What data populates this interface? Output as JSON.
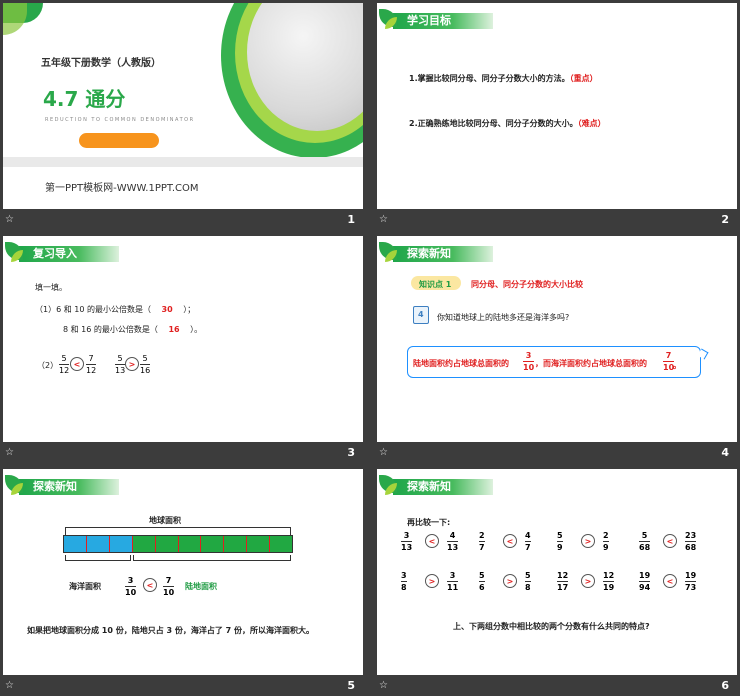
{
  "colors": {
    "accent_green": "#1f9b43",
    "accent_red": "#e02020",
    "accent_orange": "#f7941d",
    "background": "#3c3c3c"
  },
  "icons": {
    "favorite": "star-icon"
  },
  "slides": [
    {
      "number": "1",
      "subtitle": "五年级下册数学（人教版）",
      "title": "4.7  通分",
      "english": "REDUCTION TO COMMON DENOMINATOR",
      "website": "第一PPT模板网-WWW.1PPT.COM"
    },
    {
      "number": "2",
      "header": "学习目标",
      "goal1": "1.掌握比较同分母、同分子分数大小的方法。",
      "goal1_tag": "（重点）",
      "goal2": "2.正确熟练地比较同分母、同分子分数的大小。",
      "goal2_tag": "（难点）"
    },
    {
      "number": "3",
      "header": "复习导入",
      "task": "填一填。",
      "line1_pre": "（1）6 和 10 的最小公倍数是（",
      "line1_ans": "30",
      "line1_post": "）；",
      "line2_pre": "8 和 16 的最小公倍数是（",
      "line2_ans": "16",
      "line2_post": "）。",
      "part2": "（2）",
      "cmp": [
        {
          "a_num": "5",
          "a_den": "12",
          "op": "<",
          "b_num": "7",
          "b_den": "12"
        },
        {
          "a_num": "5",
          "a_den": "13",
          "op": ">",
          "b_num": "5",
          "b_den": "16"
        }
      ]
    },
    {
      "number": "4",
      "header": "探索新知",
      "kp_label": "知识点 1",
      "kp_text": "同分母、同分子分数的大小比较",
      "q_num": "4",
      "question": "你知道地球上的陆地多还是海洋多吗?",
      "bubble_a": "陆地面积约占地球总面积的",
      "bubble_f1_num": "3",
      "bubble_f1_den": "10",
      "bubble_b": "，而海洋面积约占地球总面积的",
      "bubble_f2_num": "7",
      "bubble_f2_den": "10",
      "bubble_end": "。"
    },
    {
      "number": "5",
      "header": "探索新知",
      "earth_label": "地球面积",
      "ocean_label": "海洋面积",
      "land_label": "陆地面积",
      "f1_num": "3",
      "f1_den": "10",
      "op": "<",
      "f2_num": "7",
      "f2_den": "10",
      "bar_segments": {
        "blue": 3,
        "green": 7
      },
      "summary": "如果把地球面积分成 10 份，陆地只占 3 份，海洋占了 7 份，所以海洋面积大。"
    },
    {
      "number": "6",
      "header": "探索新知",
      "prompt": "再比较一下:",
      "row1": [
        [
          "3",
          "13",
          "<",
          "4",
          "13"
        ],
        [
          "2",
          "7",
          "<",
          "4",
          "7"
        ],
        [
          "5",
          "9",
          ">",
          "2",
          "9"
        ],
        [
          "5",
          "68",
          "<",
          "23",
          "68"
        ]
      ],
      "row2": [
        [
          "3",
          "8",
          ">",
          "3",
          "11"
        ],
        [
          "5",
          "6",
          ">",
          "5",
          "8"
        ],
        [
          "12",
          "17",
          ">",
          "12",
          "19"
        ],
        [
          "19",
          "94",
          "<",
          "19",
          "73"
        ]
      ],
      "question": "上、下两组分数中相比较的两个分数有什么共同的特点?"
    }
  ]
}
